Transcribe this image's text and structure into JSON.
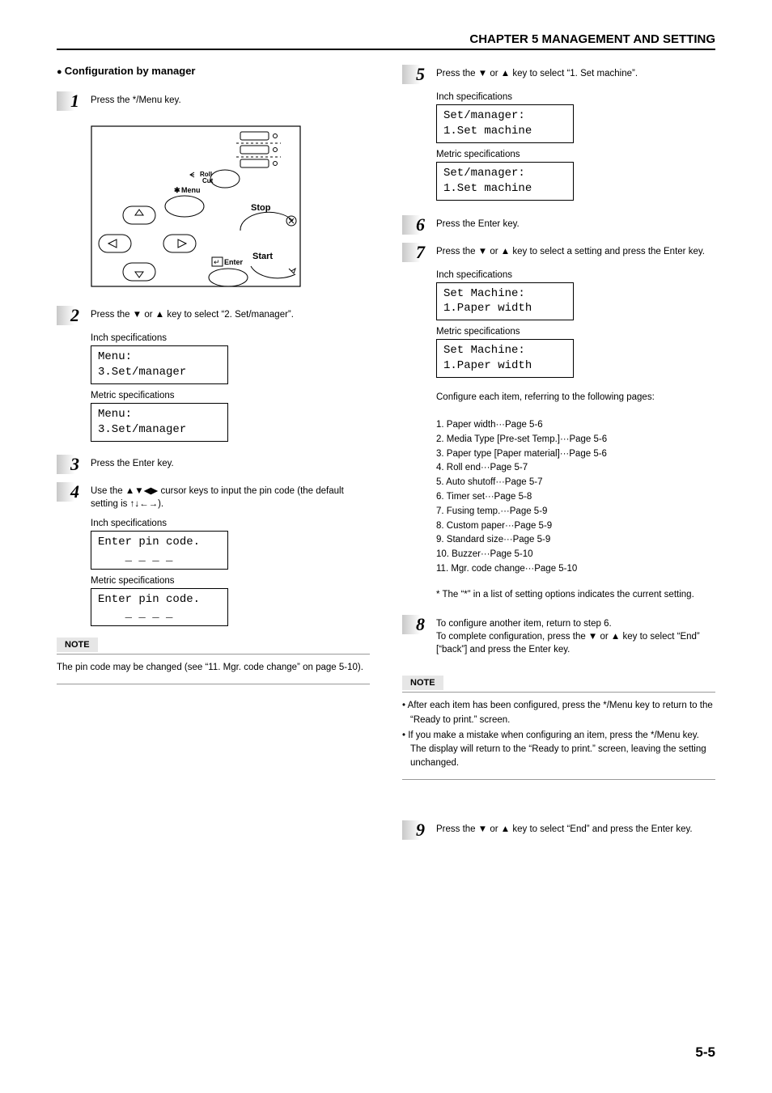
{
  "header": {
    "chapter": "CHAPTER 5  MANAGEMENT AND SETTING"
  },
  "left": {
    "title": "Configuration by manager",
    "step1": {
      "num": "1",
      "text": "Press the */Menu key."
    },
    "panel": {
      "rollcut": "Roll Cut",
      "menu": "Menu",
      "star": "✱",
      "stop": "Stop",
      "start": "Start",
      "enter": "Enter",
      "enter_icon": "↵"
    },
    "step2": {
      "num": "2",
      "text": "Press the ▼ or ▲ key to select “2. Set/manager”.",
      "spec_inch": "Inch specifications",
      "lcd_inch": "Menu:\n3.Set/manager",
      "spec_metric": "Metric specifications",
      "lcd_metric": "Menu:\n3.Set/manager"
    },
    "step3": {
      "num": "3",
      "text": "Press the Enter key."
    },
    "step4": {
      "num": "4",
      "text": "Use the ▲▼◀▶ cursor keys to input the pin code (the default setting is ↑↓←→).",
      "spec_inch": "Inch specifications",
      "lcd_inch": "Enter pin code.\n    _ _ _ _",
      "spec_metric": "Metric specifications",
      "lcd_metric": "Enter pin code.\n    _ _ _ _"
    },
    "note": {
      "label": "NOTE",
      "text": "The pin code may be changed (see “11. Mgr. code change” on page 5-10)."
    }
  },
  "right": {
    "step5": {
      "num": "5",
      "text": "Press the ▼ or ▲ key to select “1. Set machine”.",
      "spec_inch": "Inch specifications",
      "lcd_inch": "Set/manager:\n1.Set machine",
      "spec_metric": "Metric specifications",
      "lcd_metric": "Set/manager:\n1.Set machine"
    },
    "step6": {
      "num": "6",
      "text": "Press the Enter key."
    },
    "step7": {
      "num": "7",
      "text": "Press the ▼ or ▲ key to select a setting and press the Enter key.",
      "spec_inch": "Inch specifications",
      "lcd_inch": "Set Machine:\n1.Paper width",
      "spec_metric": "Metric specifications",
      "lcd_metric": "Set Machine:\n1.Paper width",
      "intro": "Configure each item, referring to the following pages:",
      "list": [
        "1. Paper width···Page 5-6",
        "2. Media Type [Pre-set Temp.]···Page 5-6",
        "3. Paper type [Paper material]···Page 5-6",
        "4. Roll end···Page 5-7",
        "5. Auto shutoff···Page 5-7",
        "6. Timer set···Page 5-8",
        "7. Fusing temp.···Page 5-9",
        "8. Custom paper···Page 5-9",
        "9. Standard size···Page 5-9",
        "10. Buzzer···Page 5-10",
        "11. Mgr. code change···Page 5-10"
      ],
      "footnote": "* The “*” in a list of setting options indicates the current setting."
    },
    "step8": {
      "num": "8",
      "text": "To configure another item, return to step 6.\nTo complete configuration, press the ▼ or ▲ key to select “End” [“back”] and press the Enter key."
    },
    "note": {
      "label": "NOTE",
      "b1": "• After each item has been configured, press the */Menu key to return to the “Ready to print.” screen.",
      "b2": "• If you make a mistake when configuring an item, press the */Menu key. The display will return to the “Ready to print.” screen, leaving the setting unchanged."
    },
    "step9": {
      "num": "9",
      "text": "Press the ▼ or ▲ key to select “End” and press the Enter key."
    }
  },
  "page": "5-5"
}
